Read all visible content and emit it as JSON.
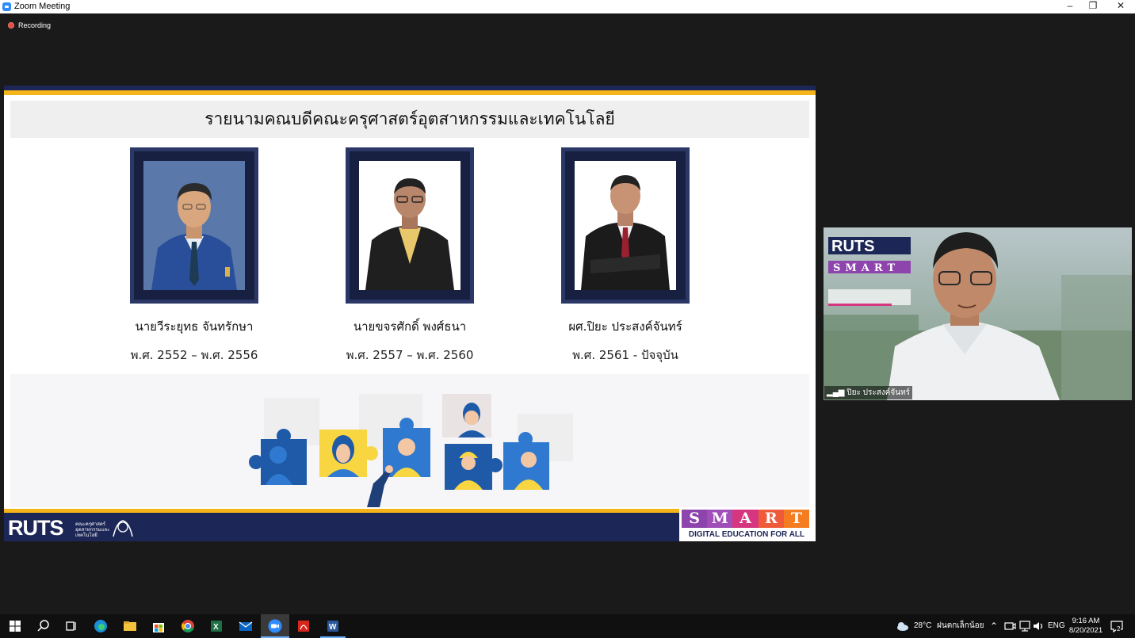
{
  "window": {
    "title": "Zoom Meeting",
    "recording_label": "Recording"
  },
  "slide": {
    "heading": "รายนามคณบดีคณะครุศาสตร์อุตสาหกรรมและเทคโนโลยี",
    "deans": [
      {
        "name": "นายวีระยุทธ จันทรักษา",
        "term": "พ.ศ. 2552 – พ.ศ. 2556"
      },
      {
        "name": "นายขจรศักดิ์ พงศ์ธนา",
        "term": "พ.ศ. 2557 – พ.ศ. 2560"
      },
      {
        "name": "ผศ.ปิยะ ประสงค์จันทร์",
        "term": "พ.ศ. 2561 - ปัจจุบัน"
      }
    ],
    "footer_logo": "RUTS",
    "footer_logo_sub": "คณะครุศาสตร์ อุตสาหกรรมและเทคโนโลยี",
    "smart_letters": [
      "S",
      "M",
      "A",
      "R",
      "T"
    ],
    "smart_tagline": "DIGITAL EDUCATION FOR ALL"
  },
  "participant": {
    "name": "ปิยะ ประสงค์จันทร์"
  },
  "taskbar": {
    "weather": "28°C",
    "weather_desc": "ฝนตกเล็กน้อย",
    "lang": "ENG",
    "time": "9:16 AM",
    "date": "8/20/2021",
    "notifications": "2"
  },
  "colors": {
    "navy": "#1c2757",
    "gold": "#f5b41a",
    "zoom_blue": "#2d8cff"
  }
}
